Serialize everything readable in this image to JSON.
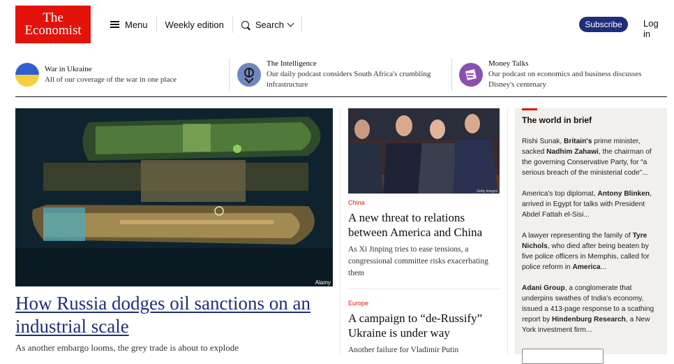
{
  "header": {
    "logo_line1": "The",
    "logo_line2": "Economist",
    "menu_label": "Menu",
    "weekly_label": "Weekly edition",
    "search_label": "Search",
    "subscribe_label": "Subscribe",
    "login_label": "Log in"
  },
  "promos": [
    {
      "title": "War in Ukraine",
      "desc": "All of our coverage of the war in one place"
    },
    {
      "title": "The Intelligence",
      "desc": "Our daily podcast considers South Africa's crumbling infrastructure"
    },
    {
      "title": "Money Talks",
      "desc": "Our podcast on economics and business discusses Disney's centenary"
    }
  ],
  "hero": {
    "credit": "Alamy",
    "headline": "How Russia dodges oil sanctions on an industrial scale",
    "subheadline": "As another embargo looms, the grey trade is about to explode"
  },
  "articles": [
    {
      "kicker": "China",
      "headline": "A new threat to relations between America and China",
      "desc": "As Xi Jinping tries to ease tensions, a congressional committee risks exacerbating them",
      "credit": "Getty Images"
    },
    {
      "kicker": "Europe",
      "headline": "A campaign to “de-Russify” Ukraine is under way",
      "desc": "Another failure for Vladimir Putin"
    }
  ],
  "brief": {
    "title": "The world in brief",
    "items": [
      [
        "Rishi Sunak, ",
        "Britain's",
        " prime minister, sacked ",
        "Nadhim Zahawi",
        ", the chairman of the governing Conservative Party, for “a serious breach of the ministerial code”..."
      ],
      [
        "America's top diplomat, ",
        "Antony Blinken",
        ", arrived in Egypt for talks with President Abdel Fattah el-Sisi...",
        "",
        ""
      ],
      [
        "A lawyer representing the family of ",
        "Tyre Nichols",
        ", who died after being beaten by five police officers in Memphis, called for police reform in ",
        "America",
        "..."
      ],
      [
        "",
        "Adani Group",
        ", a conglomerate that underpins swathes of India's economy, issued a 413-page response to a scathing report by ",
        "Hindenburg Research",
        ", a New York investment firm..."
      ]
    ]
  },
  "colors": {
    "brand_red": "#e3120b",
    "navy": "#1f2e7a",
    "brief_bg": "#f2f0ec"
  }
}
